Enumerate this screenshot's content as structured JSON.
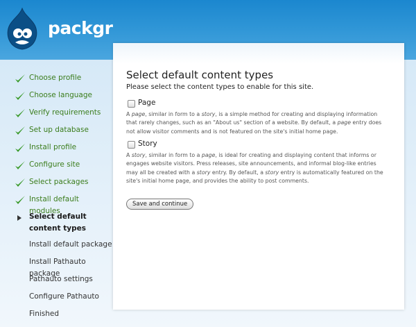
{
  "site": {
    "name": "packgr"
  },
  "steps": [
    {
      "label": "Choose profile",
      "state": "done"
    },
    {
      "label": "Choose language",
      "state": "done"
    },
    {
      "label": "Verify requirements",
      "state": "done"
    },
    {
      "label": "Set up database",
      "state": "done"
    },
    {
      "label": "Install profile",
      "state": "done"
    },
    {
      "label": "Configure site",
      "state": "done"
    },
    {
      "label": "Select packages",
      "state": "done"
    },
    {
      "label": "Install default modules",
      "state": "done"
    },
    {
      "label": "Select default content types",
      "state": "active"
    },
    {
      "label": "Install default package",
      "state": "todo"
    },
    {
      "label": "Install Pathauto package",
      "state": "todo"
    },
    {
      "label": "Pathauto settings",
      "state": "todo"
    },
    {
      "label": "Configure Pathauto",
      "state": "todo"
    },
    {
      "label": "Finished",
      "state": "todo"
    }
  ],
  "main": {
    "title": "Select default content types",
    "subtitle": "Please select the content types to enable for this site.",
    "options": [
      {
        "label": "Page",
        "checked": false,
        "description_parts": [
          [
            "A ",
            false
          ],
          [
            "page",
            true
          ],
          [
            ", similar in form to a ",
            false
          ],
          [
            "story",
            true
          ],
          [
            ", is a simple method for creating and displaying information that rarely changes, such as an \"About us\" section of a website. By default, a ",
            false
          ],
          [
            "page",
            true
          ],
          [
            " entry does not allow visitor comments and is not featured on the site's initial home page.",
            false
          ]
        ]
      },
      {
        "label": "Story",
        "checked": false,
        "description_parts": [
          [
            "A ",
            false
          ],
          [
            "story",
            true
          ],
          [
            ", similar in form to a ",
            false
          ],
          [
            "page",
            true
          ],
          [
            ", is ideal for creating and displaying content that informs or engages website visitors. Press releases, site announcements, and informal blog-like entries may all be created with a ",
            false
          ],
          [
            "story",
            true
          ],
          [
            " entry. By default, a ",
            false
          ],
          [
            "story",
            true
          ],
          [
            " entry is automatically featured on the site's initial home page, and provides the ability to post comments.",
            false
          ]
        ]
      }
    ],
    "submit_label": "Save and continue"
  },
  "colors": {
    "header": "#1b87cf",
    "done_text": "#3b7d1c",
    "check": "#3a9a2a"
  },
  "icons": {
    "done": "green-checkmark-icon",
    "active": "triangle-arrow-icon",
    "logo": "drupal-drop-logo"
  }
}
